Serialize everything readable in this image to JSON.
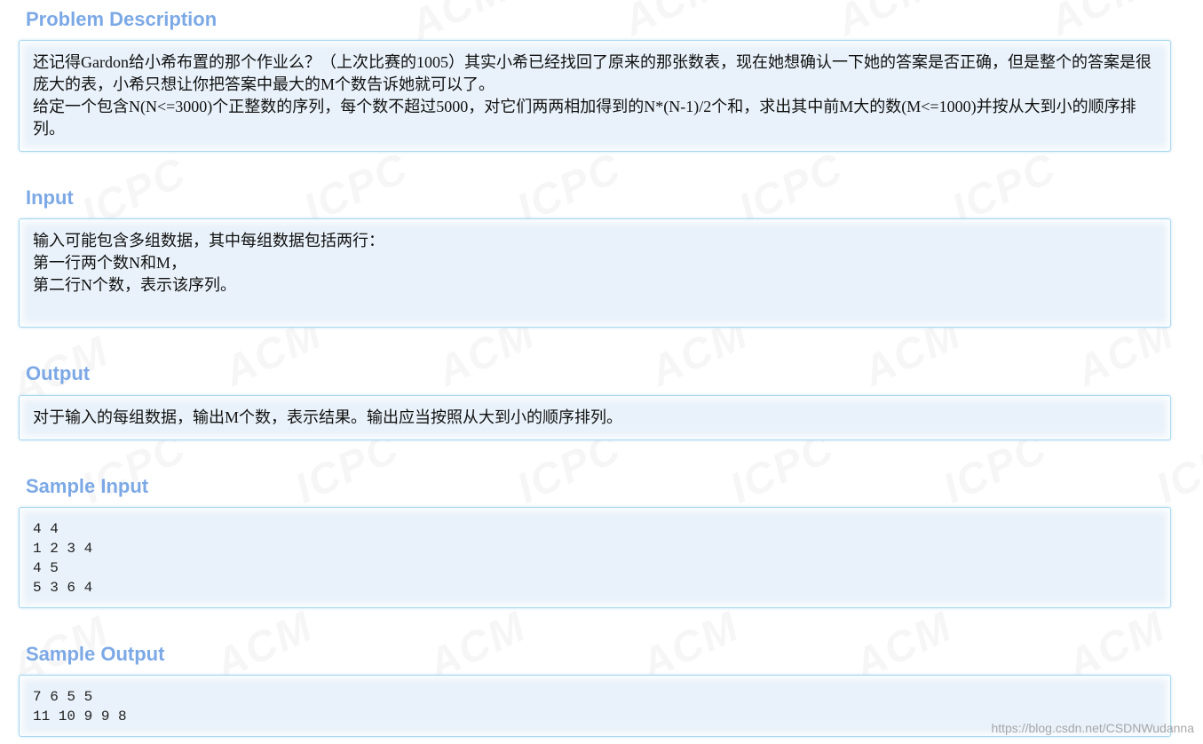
{
  "sections": {
    "description": {
      "title": "Problem Description",
      "para1": "还记得Gardon给小希布置的那个作业么？（上次比赛的1005）其实小希已经找回了原来的那张数表，现在她想确认一下她的答案是否正确，但是整个的答案是很庞大的表，小希只想让你把答案中最大的M个数告诉她就可以了。",
      "para2": "给定一个包含N(N<=3000)个正整数的序列，每个数不超过5000，对它们两两相加得到的N*(N-1)/2个和，求出其中前M大的数(M<=1000)并按从大到小的顺序排列。"
    },
    "input": {
      "title": "Input",
      "line1": "输入可能包含多组数据，其中每组数据包括两行：",
      "line2": "第一行两个数N和M，",
      "line3": "第二行N个数，表示该序列。"
    },
    "output": {
      "title": "Output",
      "line1": "对于输入的每组数据，输出M个数，表示结果。输出应当按照从大到小的顺序排列。"
    },
    "sample_input": {
      "title": "Sample Input",
      "text": "4 4\n1 2 3 4\n4 5\n5 3 6 4"
    },
    "sample_output": {
      "title": "Sample Output",
      "text": "7 6 5 5\n11 10 9 9 8"
    }
  },
  "watermark": {
    "word1": "ACM",
    "word2": "ICPC",
    "credit": "https://blog.csdn.net/CSDNWudanna"
  },
  "colors": {
    "title": "#7ca9e6",
    "panel_bg": "#e9f2fa",
    "panel_border": "#a8d8f0"
  }
}
